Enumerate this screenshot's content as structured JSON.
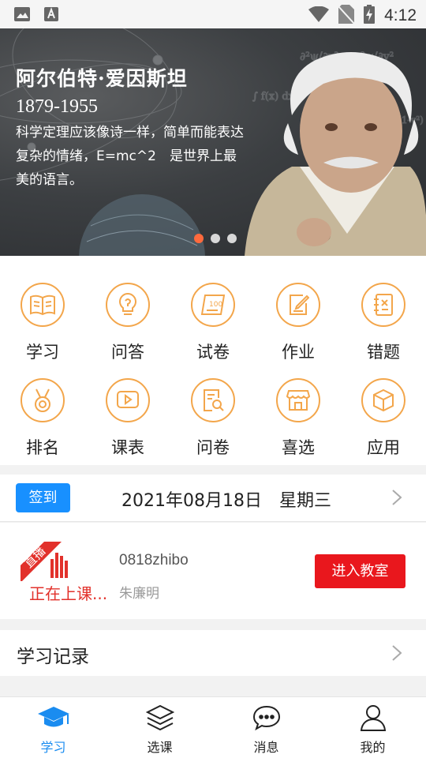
{
  "status_bar": {
    "time": "4:12",
    "left_icons": [
      "image-icon",
      "keyboard-a-icon"
    ],
    "right_icons": [
      "wifi-icon",
      "no-sim-icon",
      "battery-charging-icon"
    ]
  },
  "banner": {
    "name": "阿尔伯特·爱因斯坦",
    "years": "1879-1955",
    "quote": "科学定理应该像诗一样，简单而能表达复杂的情绪，E=mc^2　是世界上最美的语言。",
    "slide_count": 3,
    "active_slide": 1,
    "dot_active_color": "#ff6a3d"
  },
  "grid": {
    "icon_color": "#f3a64b",
    "items": [
      {
        "label": "学习",
        "icon": "book-icon"
      },
      {
        "label": "问答",
        "icon": "lightbulb-icon"
      },
      {
        "label": "试卷",
        "icon": "exam-paper-icon"
      },
      {
        "label": "作业",
        "icon": "homework-icon"
      },
      {
        "label": "错题",
        "icon": "wrong-questions-icon"
      },
      {
        "label": "排名",
        "icon": "medal-icon"
      },
      {
        "label": "课表",
        "icon": "play-video-icon"
      },
      {
        "label": "问卷",
        "icon": "survey-icon"
      },
      {
        "label": "喜选",
        "icon": "store-icon"
      },
      {
        "label": "应用",
        "icon": "cube-icon"
      }
    ]
  },
  "sign": {
    "button_label": "签到",
    "date": "2021年08月18日　星期三",
    "accent_color": "#1890ff"
  },
  "live": {
    "badge_label": "直播",
    "status": "正在上课...",
    "title": "0818zhibo",
    "teacher": "朱廉明",
    "enter_label": "进入教室",
    "accent_color": "#e9171d"
  },
  "record": {
    "label": "学习记录"
  },
  "bottom_nav": {
    "active_color": "#1a8cf0",
    "items": [
      {
        "label": "学习",
        "icon": "graduation-cap-icon",
        "active": true
      },
      {
        "label": "选课",
        "icon": "layers-icon",
        "active": false
      },
      {
        "label": "消息",
        "icon": "chat-bubble-icon",
        "active": false
      },
      {
        "label": "我的",
        "icon": "user-icon",
        "active": false
      }
    ]
  }
}
